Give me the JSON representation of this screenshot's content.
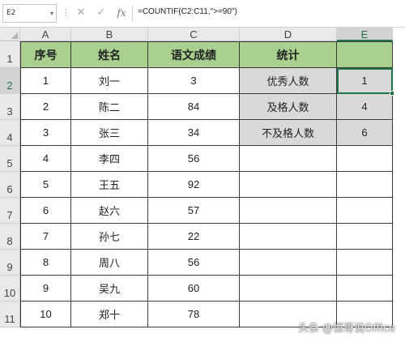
{
  "formula_bar": {
    "name_box": "E2",
    "cancel_icon": "✕",
    "confirm_icon": "✓",
    "fx_label": "fx",
    "formula": "=COUNTIF(C2:C11,\">=90\")"
  },
  "columns": [
    "A",
    "B",
    "C",
    "D",
    "E"
  ],
  "rows": [
    "1",
    "2",
    "3",
    "4",
    "5",
    "6",
    "7",
    "8",
    "9",
    "10",
    "11"
  ],
  "header": {
    "a": "序号",
    "b": "姓名",
    "c": "语文成绩",
    "d": "统计",
    "e": ""
  },
  "records": [
    {
      "seq": "1",
      "name": "刘一",
      "score": "3"
    },
    {
      "seq": "2",
      "name": "陈二",
      "score": "84"
    },
    {
      "seq": "3",
      "name": "张三",
      "score": "34"
    },
    {
      "seq": "4",
      "name": "李四",
      "score": "56"
    },
    {
      "seq": "5",
      "name": "王五",
      "score": "92"
    },
    {
      "seq": "6",
      "name": "赵六",
      "score": "57"
    },
    {
      "seq": "7",
      "name": "孙七",
      "score": "22"
    },
    {
      "seq": "8",
      "name": "周八",
      "score": "56"
    },
    {
      "seq": "9",
      "name": "吴九",
      "score": "60"
    },
    {
      "seq": "10",
      "name": "郑十",
      "score": "78"
    }
  ],
  "stats": [
    {
      "label": "优秀人数",
      "value": "1"
    },
    {
      "label": "及格人数",
      "value": "4"
    },
    {
      "label": "不及格人数",
      "value": "6"
    }
  ],
  "selected_cell": "E2",
  "colors": {
    "header_fill": "#a9d08e",
    "stats_fill": "#d9d9d9",
    "selection": "#217346"
  },
  "watermark": "头条 @恒哥说Office"
}
